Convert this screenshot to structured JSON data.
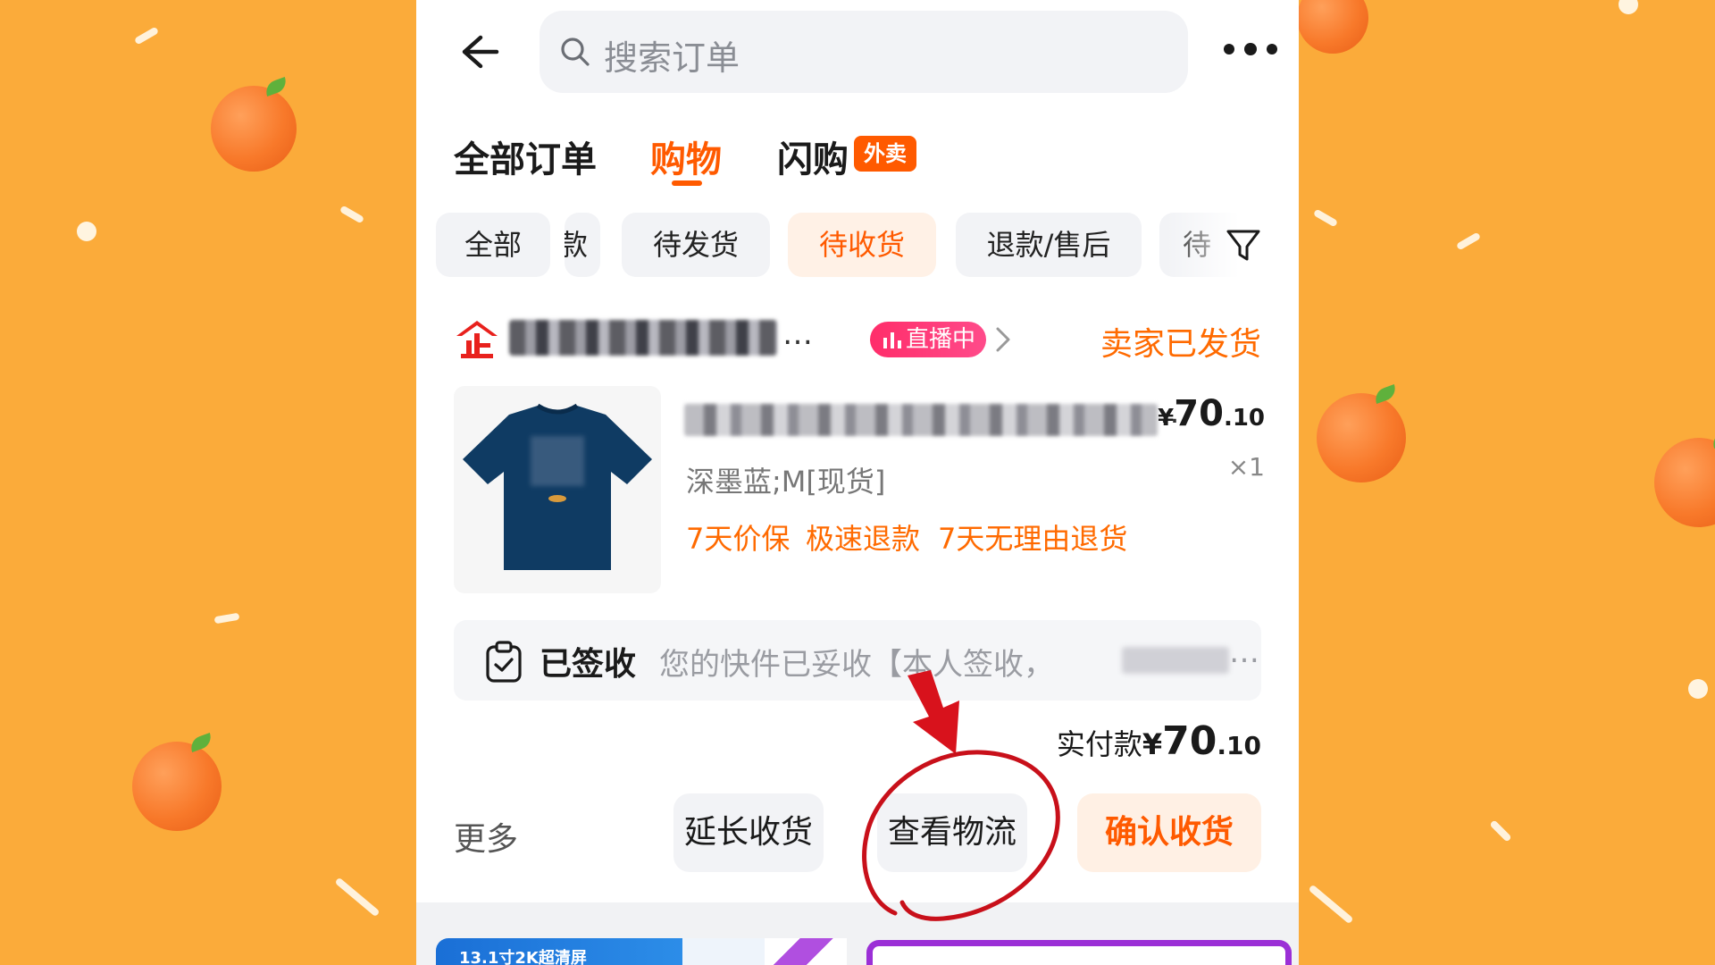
{
  "search": {
    "placeholder": "搜索订单"
  },
  "tabs": [
    {
      "label": "全部订单",
      "active": false
    },
    {
      "label": "购物",
      "active": true
    },
    {
      "label": "闪购",
      "active": false,
      "badge": "外卖"
    }
  ],
  "filter_chips": [
    {
      "label": "全部"
    },
    {
      "label": "款"
    },
    {
      "label": "待发货"
    },
    {
      "label": "待收货",
      "active": true
    },
    {
      "label": "退款/售后"
    },
    {
      "label": "待"
    }
  ],
  "order": {
    "store_suffix": "…",
    "live_badge": "直播中",
    "status": "卖家已发货",
    "product": {
      "title_suffix": "…",
      "sku": "深墨蓝;M[现货]",
      "price_currency": "¥",
      "price_main": "70",
      "price_decimal": ".10",
      "quantity": "×1",
      "services": [
        "7天价保",
        "极速退款",
        "7天无理由退货"
      ]
    },
    "logistics": {
      "status": "已签收",
      "message": "您的快件已妥收【本人签收，",
      "ellipsis": "…"
    },
    "paid": {
      "label": "实付款",
      "currency": "¥",
      "main": "70",
      "decimal": ".10"
    },
    "actions": {
      "more": "更多",
      "extend": "延长收货",
      "track": "查看物流",
      "confirm": "确认收货"
    }
  },
  "ad_banner": {
    "text": "13.1寸2K超清屏"
  },
  "colors": {
    "background": "#fbab3a",
    "accent": "#ff5a00",
    "live_badge": "#ff2d6a",
    "annotation": "#d8121c",
    "tshirt": "#0f3b63"
  },
  "icons": [
    "back-arrow-icon",
    "search-icon",
    "more-dots-icon",
    "filter-icon",
    "store-icon",
    "live-bars-icon",
    "chevron-right-icon",
    "clipboard-check-icon"
  ]
}
